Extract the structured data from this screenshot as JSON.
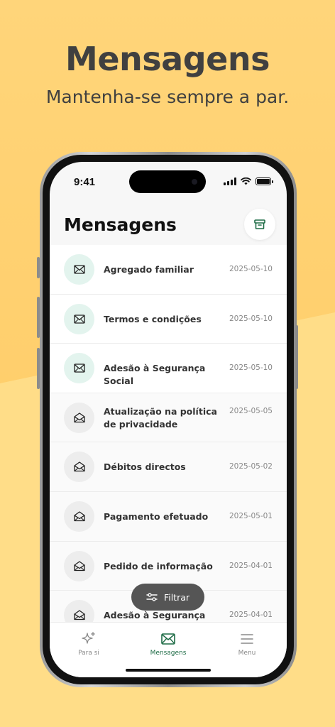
{
  "promo": {
    "headline": "Mensagens",
    "subline": "Mantenha-se sempre a par."
  },
  "status_bar": {
    "time": "9:41"
  },
  "page": {
    "title": "Mensagens"
  },
  "messages": [
    {
      "title": "Agregado familiar",
      "date": "2025-05-10",
      "unread": true
    },
    {
      "title": "Termos e condições",
      "date": "2025-05-10",
      "unread": true
    },
    {
      "title": "Adesão à Segurança Social",
      "date": "2025-05-10",
      "unread": true
    },
    {
      "title": "Atualização na política de privacidade",
      "date": "2025-05-05",
      "unread": false
    },
    {
      "title": "Débitos directos",
      "date": "2025-05-02",
      "unread": false
    },
    {
      "title": "Pagamento efetuado",
      "date": "2025-05-01",
      "unread": false
    },
    {
      "title": "Pedido de informação",
      "date": "2025-04-01",
      "unread": false
    },
    {
      "title": "Adesão à Segurança Social",
      "date": "2025-04-01",
      "unread": false
    }
  ],
  "filter": {
    "label": "Filtrar"
  },
  "tabs": [
    {
      "label": "Para si",
      "icon": "sparkle-icon",
      "active": false
    },
    {
      "label": "Mensagens",
      "icon": "envelope-icon",
      "active": true
    },
    {
      "label": "Menu",
      "icon": "menu-icon",
      "active": false
    }
  ],
  "colors": {
    "accent": "#1d6b45",
    "unread_icon_bg": "#e3f4ee",
    "background": "#ffc960"
  }
}
